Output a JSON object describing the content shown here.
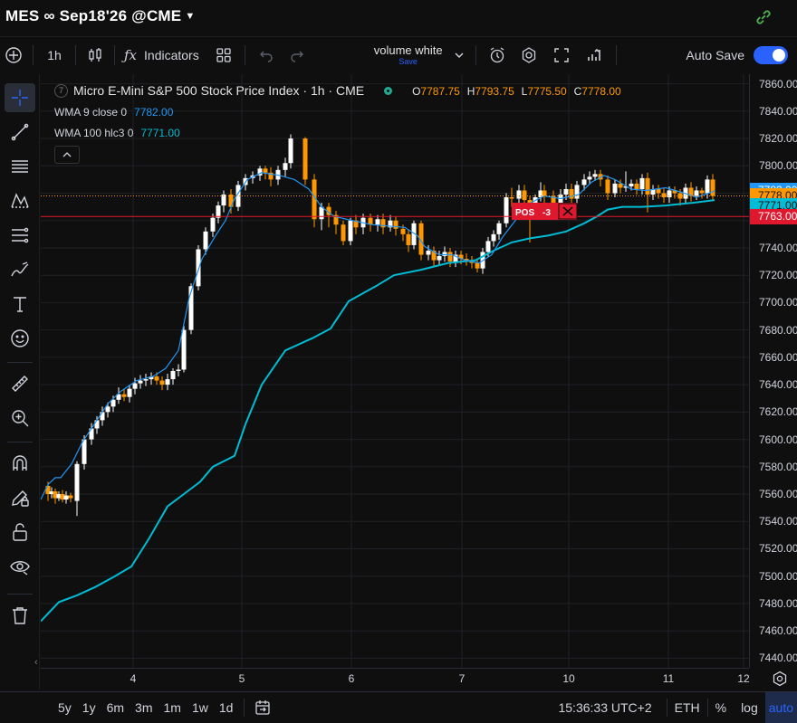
{
  "title": {
    "symbol": "MES ∞ Sep18'26 @CME"
  },
  "toolbar": {
    "add_symbol_icon": "plus-circle-icon",
    "interval": "1h",
    "chart_type_icon": "candles-icon",
    "indicators_label": "Indicators",
    "layout_name": "volume white",
    "layout_status": "Save",
    "autosave_label": "Auto Save",
    "autosave_on": true
  },
  "legend": {
    "badge": "7",
    "title": "Micro E-Mini S&P 500 Stock Price Index · 1h · CME",
    "ohlc": {
      "o_label": "O",
      "o": "7787.75",
      "h_label": "H",
      "h": "7793.75",
      "l_label": "L",
      "l": "7775.50",
      "c_label": "C",
      "c": "7778.00"
    },
    "wma9_label": "WMA 9 close 0",
    "wma9_value": "7782.00",
    "wma100_label": "WMA 100 hlc3 0",
    "wma100_value": "7771.00"
  },
  "position": {
    "label": "POS",
    "qty": "-3"
  },
  "price_axis": {
    "ticks": [
      "7860.00",
      "7840.00",
      "7820.00",
      "7800.00",
      "7780.00",
      "7760.00",
      "7740.00",
      "7720.00",
      "7700.00",
      "7680.00",
      "7660.00",
      "7640.00",
      "7620.00",
      "7600.00",
      "7580.00",
      "7560.00",
      "7540.00",
      "7520.00",
      "7500.00",
      "7480.00",
      "7460.00",
      "7440.00"
    ],
    "badge_wma9": "7782.00",
    "badge_close": "7778.00",
    "badge_wma100": "7771.00",
    "badge_pos": "7763.00"
  },
  "time_axis": {
    "ticks": [
      "4",
      "5",
      "6",
      "7",
      "10",
      "11",
      "12"
    ]
  },
  "bottom": {
    "ranges": [
      "5y",
      "1y",
      "6m",
      "3m",
      "1m",
      "1w",
      "1d"
    ],
    "clock": "15:36:33 UTC+2",
    "session": "ETH",
    "percent": "%",
    "log": "log",
    "auto": "auto"
  },
  "colors": {
    "up": "#ffffff",
    "down": "#ff9800",
    "wma9": "#2196f3",
    "wma100": "#00bcd4",
    "pos": "#e0182d",
    "accent": "#2962ff"
  },
  "chart_data": {
    "type": "candlestick",
    "y_range": [
      7433,
      7867
    ],
    "wma9": [
      [
        0,
        7556
      ],
      [
        8,
        7567
      ],
      [
        16,
        7572
      ],
      [
        22,
        7572
      ],
      [
        34,
        7582
      ],
      [
        46,
        7598
      ],
      [
        60,
        7612
      ],
      [
        74,
        7626
      ],
      [
        88,
        7635
      ],
      [
        106,
        7643
      ],
      [
        124,
        7646
      ],
      [
        138,
        7652
      ],
      [
        152,
        7665
      ],
      [
        164,
        7704
      ],
      [
        178,
        7732
      ],
      [
        192,
        7748
      ],
      [
        204,
        7760
      ],
      [
        214,
        7776
      ],
      [
        228,
        7790
      ],
      [
        244,
        7795
      ],
      [
        264,
        7793
      ],
      [
        280,
        7790
      ],
      [
        296,
        7783
      ],
      [
        310,
        7770
      ],
      [
        324,
        7763
      ],
      [
        344,
        7760
      ],
      [
        366,
        7757
      ],
      [
        384,
        7756
      ],
      [
        402,
        7755
      ],
      [
        416,
        7749
      ],
      [
        424,
        7741
      ],
      [
        440,
        7735
      ],
      [
        454,
        7735
      ],
      [
        468,
        7731
      ],
      [
        484,
        7729
      ],
      [
        498,
        7735
      ],
      [
        510,
        7748
      ],
      [
        524,
        7760
      ],
      [
        538,
        7772
      ],
      [
        556,
        7778
      ],
      [
        574,
        7776
      ],
      [
        594,
        7779
      ],
      [
        608,
        7788
      ],
      [
        622,
        7793
      ],
      [
        634,
        7790
      ],
      [
        652,
        7783
      ],
      [
        668,
        7782
      ],
      [
        690,
        7784
      ],
      [
        706,
        7781
      ],
      [
        724,
        7777
      ],
      [
        742,
        7781
      ],
      [
        744,
        7782
      ]
    ],
    "wma100": [
      [
        0,
        7467
      ],
      [
        20,
        7481
      ],
      [
        40,
        7486
      ],
      [
        60,
        7492
      ],
      [
        82,
        7500
      ],
      [
        100,
        7507
      ],
      [
        120,
        7528
      ],
      [
        140,
        7551
      ],
      [
        160,
        7561
      ],
      [
        176,
        7569
      ],
      [
        190,
        7580
      ],
      [
        214,
        7588
      ],
      [
        226,
        7611
      ],
      [
        244,
        7640
      ],
      [
        270,
        7665
      ],
      [
        300,
        7674
      ],
      [
        320,
        7681
      ],
      [
        340,
        7701
      ],
      [
        370,
        7712
      ],
      [
        390,
        7720
      ],
      [
        420,
        7724
      ],
      [
        450,
        7729
      ],
      [
        480,
        7731
      ],
      [
        500,
        7738
      ],
      [
        520,
        7744
      ],
      [
        540,
        7747
      ],
      [
        560,
        7749
      ],
      [
        580,
        7752
      ],
      [
        600,
        7758
      ],
      [
        614,
        7763
      ],
      [
        626,
        7768
      ],
      [
        642,
        7770
      ],
      [
        664,
        7770
      ],
      [
        690,
        7771
      ],
      [
        720,
        7773
      ],
      [
        744,
        7775
      ]
    ],
    "candles": [
      [
        8,
        7566,
        7560,
        7555,
        7569
      ],
      [
        12,
        7560,
        7562,
        7557,
        7565
      ],
      [
        16,
        7562,
        7557,
        7553,
        7564
      ],
      [
        20,
        7557,
        7560,
        7555,
        7562
      ],
      [
        24,
        7560,
        7556,
        7554,
        7563
      ],
      [
        28,
        7556,
        7559,
        7553,
        7562
      ],
      [
        33,
        7559,
        7557,
        7554,
        7561
      ],
      [
        40,
        7555,
        7582,
        7544,
        7584
      ],
      [
        48,
        7582,
        7600,
        7578,
        7603
      ],
      [
        56,
        7600,
        7608,
        7596,
        7612
      ],
      [
        62,
        7608,
        7614,
        7604,
        7617
      ],
      [
        68,
        7614,
        7620,
        7610,
        7624
      ],
      [
        74,
        7620,
        7624,
        7616,
        7627
      ],
      [
        80,
        7624,
        7629,
        7620,
        7632
      ],
      [
        86,
        7629,
        7633,
        7626,
        7638
      ],
      [
        92,
        7633,
        7631,
        7628,
        7637
      ],
      [
        98,
        7631,
        7637,
        7627,
        7640
      ],
      [
        104,
        7637,
        7641,
        7633,
        7645
      ],
      [
        110,
        7641,
        7643,
        7637,
        7647
      ],
      [
        116,
        7643,
        7644,
        7639,
        7648
      ],
      [
        122,
        7644,
        7646,
        7640,
        7649
      ],
      [
        128,
        7646,
        7643,
        7640,
        7649
      ],
      [
        134,
        7643,
        7640,
        7636,
        7646
      ],
      [
        140,
        7640,
        7644,
        7636,
        7648
      ],
      [
        146,
        7644,
        7650,
        7640,
        7652
      ],
      [
        152,
        7650,
        7651,
        7646,
        7655
      ],
      [
        158,
        7651,
        7680,
        7649,
        7683
      ],
      [
        166,
        7680,
        7712,
        7677,
        7714
      ],
      [
        174,
        7712,
        7739,
        7709,
        7742
      ],
      [
        182,
        7739,
        7752,
        7735,
        7755
      ],
      [
        190,
        7752,
        7762,
        7748,
        7765
      ],
      [
        196,
        7762,
        7771,
        7758,
        7774
      ],
      [
        202,
        7771,
        7779,
        7766,
        7782
      ],
      [
        210,
        7779,
        7770,
        7765,
        7783
      ],
      [
        218,
        7770,
        7786,
        7767,
        7789
      ],
      [
        226,
        7786,
        7791,
        7782,
        7794
      ],
      [
        234,
        7791,
        7793,
        7787,
        7796
      ],
      [
        242,
        7793,
        7798,
        7789,
        7800
      ],
      [
        248,
        7798,
        7795,
        7790,
        7800
      ],
      [
        254,
        7795,
        7790,
        7785,
        7799
      ],
      [
        262,
        7790,
        7797,
        7786,
        7800
      ],
      [
        270,
        7797,
        7802,
        7792,
        7806
      ],
      [
        276,
        7802,
        7820,
        7798,
        7823
      ],
      [
        292,
        7820,
        7790,
        7786,
        7821
      ],
      [
        302,
        7790,
        7761,
        7755,
        7794
      ],
      [
        310,
        7761,
        7770,
        7753,
        7773
      ],
      [
        318,
        7770,
        7764,
        7755,
        7773
      ],
      [
        326,
        7764,
        7757,
        7750,
        7767
      ],
      [
        334,
        7757,
        7745,
        7742,
        7760
      ],
      [
        342,
        7745,
        7760,
        7742,
        7762
      ],
      [
        348,
        7760,
        7755,
        7750,
        7764
      ],
      [
        356,
        7755,
        7762,
        7750,
        7765
      ],
      [
        364,
        7762,
        7757,
        7752,
        7765
      ],
      [
        372,
        7757,
        7761,
        7752,
        7764
      ],
      [
        378,
        7761,
        7755,
        7750,
        7765
      ],
      [
        386,
        7755,
        7760,
        7752,
        7764
      ],
      [
        392,
        7760,
        7754,
        7749,
        7763
      ],
      [
        400,
        7754,
        7750,
        7745,
        7757
      ],
      [
        406,
        7750,
        7742,
        7737,
        7753
      ],
      [
        412,
        7742,
        7758,
        7739,
        7760
      ],
      [
        420,
        7758,
        7735,
        7731,
        7760
      ],
      [
        428,
        7735,
        7738,
        7731,
        7742
      ],
      [
        434,
        7738,
        7731,
        7726,
        7741
      ],
      [
        440,
        7731,
        7734,
        7727,
        7738
      ],
      [
        446,
        7734,
        7737,
        7730,
        7741
      ],
      [
        452,
        7737,
        7730,
        7726,
        7740
      ],
      [
        458,
        7730,
        7735,
        7726,
        7738
      ],
      [
        464,
        7735,
        7732,
        7728,
        7738
      ],
      [
        470,
        7732,
        7731,
        7727,
        7736
      ],
      [
        476,
        7731,
        7729,
        7725,
        7734
      ],
      [
        482,
        7729,
        7725,
        7722,
        7732
      ],
      [
        488,
        7725,
        7737,
        7721,
        7740
      ],
      [
        494,
        7737,
        7745,
        7733,
        7748
      ],
      [
        500,
        7745,
        7750,
        7741,
        7753
      ],
      [
        506,
        7750,
        7758,
        7746,
        7760
      ],
      [
        514,
        7758,
        7777,
        7755,
        7780
      ],
      [
        520,
        7777,
        7776,
        7770,
        7784
      ],
      [
        528,
        7776,
        7782,
        7772,
        7786
      ],
      [
        534,
        7782,
        7775,
        7770,
        7786
      ],
      [
        540,
        7775,
        7770,
        7744,
        7778
      ],
      [
        546,
        7770,
        7777,
        7766,
        7779
      ],
      [
        552,
        7777,
        7782,
        7774,
        7788
      ],
      [
        556,
        7782,
        7778,
        7773,
        7786
      ],
      [
        566,
        7778,
        7772,
        7766,
        7782
      ],
      [
        574,
        7772,
        7779,
        7768,
        7783
      ],
      [
        580,
        7779,
        7783,
        7775,
        7787
      ],
      [
        586,
        7783,
        7776,
        7772,
        7787
      ],
      [
        592,
        7776,
        7786,
        7772,
        7789
      ],
      [
        600,
        7786,
        7790,
        7782,
        7794
      ],
      [
        606,
        7790,
        7792,
        7787,
        7796
      ],
      [
        612,
        7792,
        7794,
        7789,
        7797
      ],
      [
        618,
        7794,
        7790,
        7785,
        7797
      ],
      [
        626,
        7790,
        7780,
        7775,
        7793
      ],
      [
        634,
        7780,
        7787,
        7777,
        7790
      ],
      [
        640,
        7787,
        7784,
        7780,
        7790
      ],
      [
        646,
        7784,
        7785,
        7781,
        7796
      ],
      [
        652,
        7785,
        7787,
        7782,
        7790
      ],
      [
        658,
        7787,
        7783,
        7779,
        7790
      ],
      [
        664,
        7783,
        7791,
        7779,
        7794
      ],
      [
        670,
        7791,
        7779,
        7766,
        7795
      ],
      [
        676,
        7779,
        7783,
        7775,
        7786
      ],
      [
        682,
        7783,
        7780,
        7776,
        7786
      ],
      [
        688,
        7780,
        7777,
        7773,
        7784
      ],
      [
        694,
        7777,
        7782,
        7773,
        7785
      ],
      [
        700,
        7782,
        7780,
        7776,
        7785
      ],
      [
        706,
        7780,
        7776,
        7771,
        7783
      ],
      [
        712,
        7776,
        7784,
        7772,
        7787
      ],
      [
        718,
        7784,
        7778,
        7774,
        7788
      ],
      [
        724,
        7778,
        7782,
        7775,
        7785
      ],
      [
        730,
        7782,
        7780,
        7776,
        7784
      ],
      [
        736,
        7780,
        7790,
        7776,
        7793
      ],
      [
        742,
        7790,
        7778,
        7775,
        7794
      ]
    ],
    "price_lines": {
      "close": 7778,
      "position": 7763
    }
  }
}
